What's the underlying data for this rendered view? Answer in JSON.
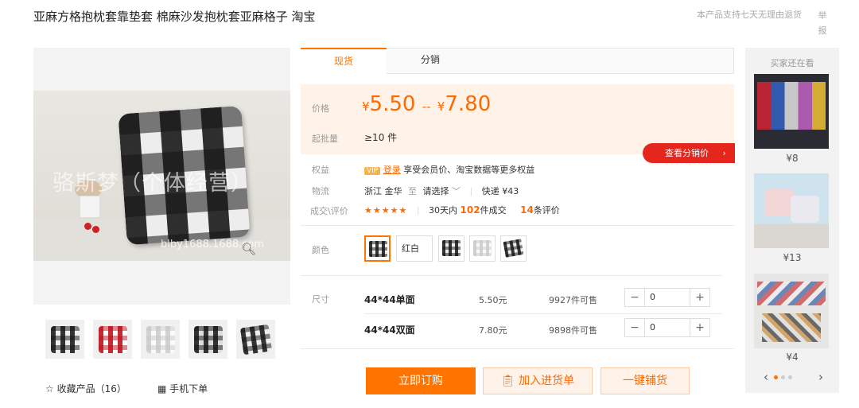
{
  "header": {
    "title": "亚麻方格抱枕套靠垫套 棉麻沙发抱枕套亚麻格子 淘宝",
    "return_notice": "本产品支持七天无理由退货",
    "report": "举报"
  },
  "gallery": {
    "watermark_text": "骆斯梦（个体经营）",
    "watermark_url": "blby1688.1688.com",
    "favorite_label": "收藏产品（16）",
    "mobile_order_label": "手机下单"
  },
  "tabs": [
    "现货",
    "分销"
  ],
  "price": {
    "label": "价格",
    "currency": "¥",
    "low": "5.50",
    "range_sep": "--",
    "high": "7.80",
    "moq_label": "起批量",
    "moq_value": "≥10 件",
    "dist_price_button": "查看分销价"
  },
  "benefits": {
    "label": "权益",
    "vip_badge": "VIP",
    "login_link": "登录",
    "text": "享受会员价、淘宝数据等更多权益"
  },
  "logistics": {
    "label": "物流",
    "origin": "浙江 金华",
    "to": "至",
    "destination_select": "请选择",
    "express": "快递 ¥43"
  },
  "deals": {
    "label": "成交\\评价",
    "stars": "★★★★★",
    "period": "30天内",
    "count": "102",
    "count_suffix": "件成交",
    "reviews": "14",
    "reviews_suffix": "条评价"
  },
  "colors": {
    "label": "颜色",
    "options": [
      "黑白格",
      "红白色",
      "黑白格",
      "白灰格",
      "黑白格"
    ],
    "visible_text_option": "红白色"
  },
  "sizes": {
    "label": "尺寸",
    "rows": [
      {
        "name": "44*44单面",
        "price": "5.50元",
        "stock": "9927件可售",
        "qty": "0"
      },
      {
        "name": "44*44双面",
        "price": "7.80元",
        "stock": "9898件可售",
        "qty": "0"
      }
    ]
  },
  "actions": {
    "order_now": "立即订购",
    "add_cart": "加入进货单",
    "one_click": "一键铺货"
  },
  "side": {
    "title": "买家还在看",
    "items": [
      {
        "price": "¥8"
      },
      {
        "price": "¥13"
      },
      {
        "price": "¥4"
      }
    ]
  },
  "colors_theme": {
    "accent": "#ff7300",
    "price": "#ff6a00",
    "badge_red": "#e4261c",
    "price_bg": "#fff2e8"
  }
}
